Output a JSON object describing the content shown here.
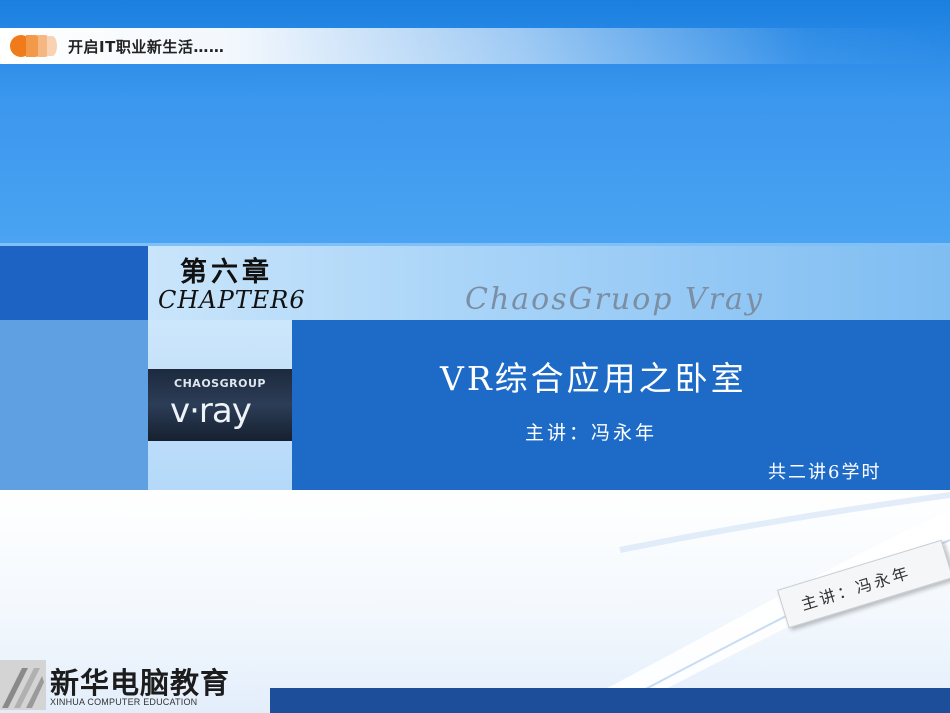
{
  "header": {
    "tagline": "开启IT职业新生活……"
  },
  "title_band": {
    "chapter_title": "第六章",
    "chapter_number": "CHAPTER6",
    "product": "ChaosGruop  Vray"
  },
  "logo": {
    "group_text": "CHAOSGROUP",
    "word": "v·ray"
  },
  "main": {
    "lesson_title": "VR综合应用之卧室",
    "speaker": "主讲：冯永年",
    "hours": "共二讲6学时"
  },
  "card": {
    "text": "主讲：冯永年"
  },
  "footer": {
    "brand_name": "新华电脑教育",
    "brand_sub": "XINHUA COMPUTER EDUCATION"
  },
  "colors": {
    "primary_blue": "#1e6bc7",
    "sky_blue": "#3b97ee",
    "accent_orange": "#f07b1a",
    "footer_navy": "#1c4e9a"
  }
}
